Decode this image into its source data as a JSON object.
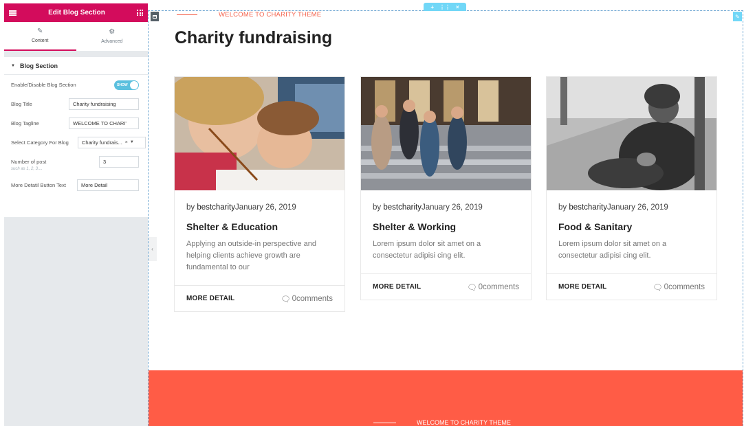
{
  "panel": {
    "title": "Edit Blog Section",
    "tabs": [
      {
        "label": "Content",
        "icon": "pencil-icon"
      },
      {
        "label": "Advanced",
        "icon": "gear-icon"
      }
    ],
    "section_title": "Blog Section",
    "fields": {
      "enable_label": "Enable/Disable Blog Section",
      "enable_value": "SHOW",
      "title_label": "Blog Title",
      "title_value": "Charity fundraising",
      "tagline_label": "Blog Tagline",
      "tagline_value": "WELCOME TO CHARI'",
      "category_label": "Select Category For Blog",
      "category_value": "Charity fundrais...",
      "category_clear": "×",
      "posts_label": "Number of post",
      "posts_value": "3",
      "posts_hint": "such as 1, 2, 3....",
      "button_label": "More Detatil Button Text",
      "button_value": "More Detail"
    }
  },
  "preview": {
    "tagline": "WELCOME TO CHARITY THEME",
    "title": "Charity fundraising",
    "footer_tagline": "WELCOME TO CHARITY THEME",
    "posts": [
      {
        "by": "by ",
        "author": "bestcharity",
        "date": "January 26, 2019",
        "title": "Shelter & Education",
        "excerpt": "Applying an outside-in perspective and helping clients achieve growth are fundamental to our",
        "more": "MORE DETAIL",
        "comments": "0comments"
      },
      {
        "by": "by ",
        "author": "bestcharity",
        "date": "January 26, 2019",
        "title": "Shelter & Working",
        "excerpt": "Lorem ipsum dolor sit amet on a consectetur adipisi cing elit.",
        "more": "MORE DETAIL",
        "comments": "0comments"
      },
      {
        "by": "by ",
        "author": "bestcharity",
        "date": "January 26, 2019",
        "title": "Food & Sanitary",
        "excerpt": "Lorem ipsum dolor sit amet on a consectetur adipisi cing elit.",
        "more": "MORE DETAIL",
        "comments": "0comments"
      }
    ]
  },
  "colors": {
    "brand": "#d30c5c",
    "accent": "#f4604a",
    "footer": "#ff5c46",
    "editor_handle": "#71d7f7"
  }
}
